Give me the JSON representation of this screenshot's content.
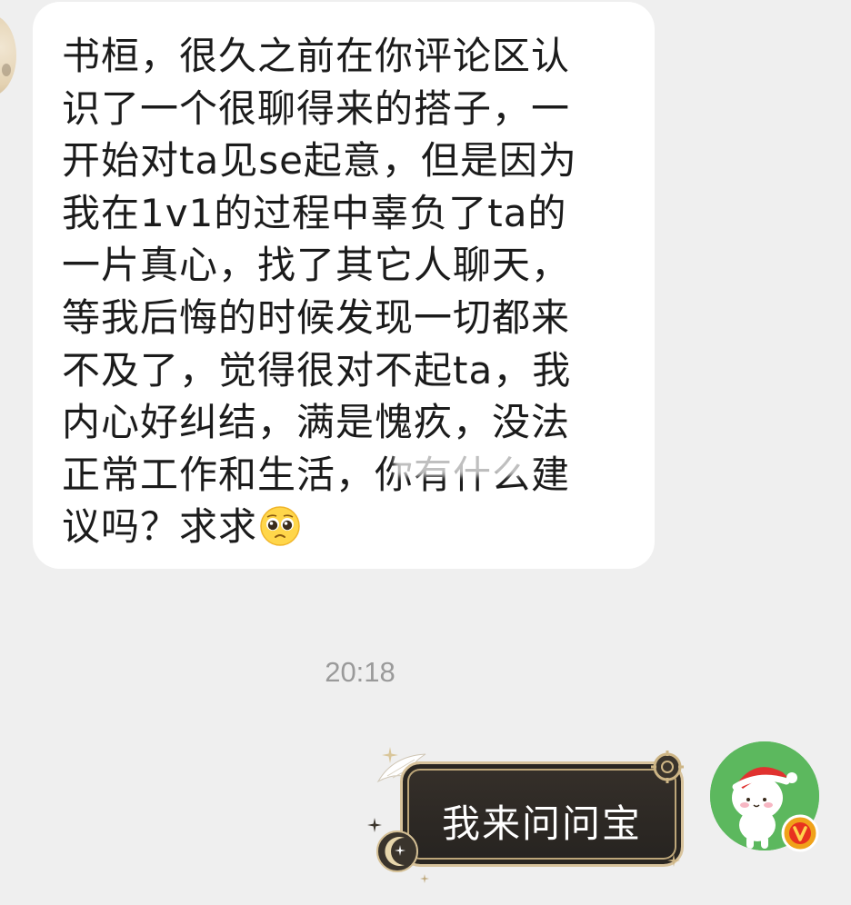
{
  "incoming_message": {
    "lines": [
      "书桓，很久之前在你评论区认",
      "识了一个很聊得来的搭子，一",
      "开始对ta见se起意，但是因为",
      "我在1v1的过程中辜负了ta的",
      "一片真心，找了其它人聊天，",
      "等我后悔的时候发现一切都来",
      "不及了，觉得很对不起ta，我",
      "内心好纠结，满是愧疚，没法",
      "正常工作和生活，你有什么建",
      "议吗？求求"
    ],
    "emoji": "pleading-face-emoji"
  },
  "timestamp": "20:18",
  "outgoing_message": {
    "text": "我来问问宝"
  },
  "colors": {
    "background": "#efefef",
    "bubble_in": "#ffffff",
    "bubble_out": "#2b2723",
    "bubble_out_border": "#d8c39c",
    "avatar_right_bg": "#5cb85e",
    "verified_badge": "#f0a21a"
  },
  "icons": {
    "left_avatar": "user-avatar-icon",
    "right_avatar": "bunny-santa-avatar-icon",
    "badge": "verified-v-badge-icon"
  }
}
